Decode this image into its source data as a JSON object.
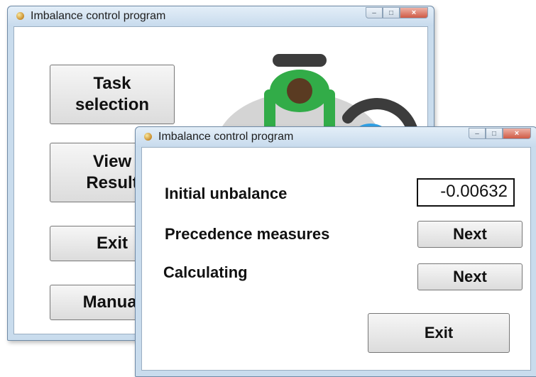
{
  "back_window": {
    "title": "Imbalance control program",
    "buttons": {
      "task_selection": "Task\nselection",
      "view_result": "View\nResult",
      "exit": "Exit",
      "manual": "Manual"
    }
  },
  "front_window": {
    "title": "Imbalance control program",
    "initial_unbalance_label": "Initial unbalance",
    "initial_unbalance_value": "-0.00632",
    "precedence_label": "Precedence measures",
    "precedence_next": "Next",
    "calculating_label": "Calculating",
    "calculating_next": "Next",
    "exit_label": "Exit"
  },
  "window_controls": {
    "minimize": "–",
    "maximize": "□",
    "close": "×"
  },
  "colors": {
    "title_bar": "#c9dced",
    "button_face": "#e6e6e6",
    "close_button": "#d45a45"
  },
  "icons": [
    "app-icon",
    "minimize-icon",
    "maximize-icon",
    "close-icon",
    "people-meeting-illustration"
  ]
}
